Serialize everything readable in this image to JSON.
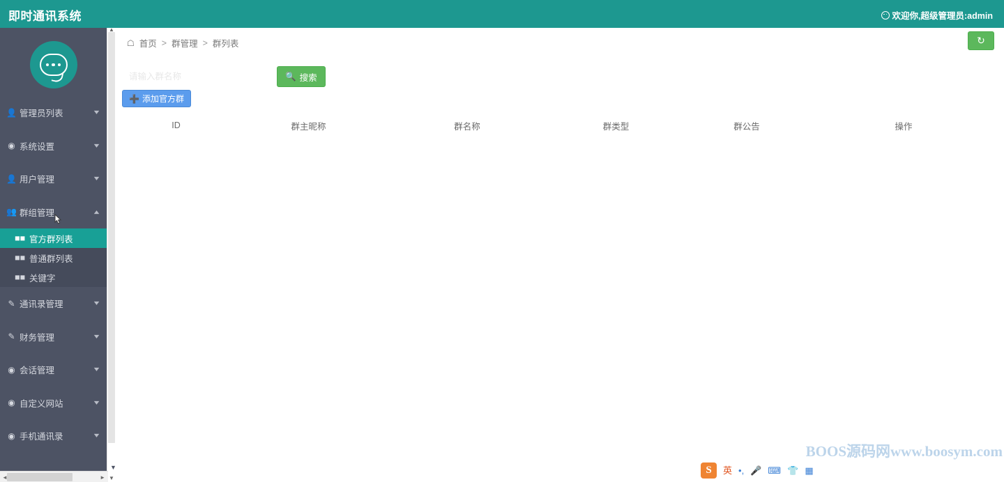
{
  "header": {
    "title": "即时通讯系统",
    "user_greeting": "欢迎你,超级管理员:admin",
    "smiley_icon": "smiley-face-icon",
    "bg_color": "#1d9890"
  },
  "sidebar": {
    "bg_color": "#4d5364",
    "logo_icon": "chat-bubble-logo",
    "active_color": "#18a096",
    "items": [
      {
        "label": "管理员列表",
        "icon": "user-icon",
        "caret": "chevron-down-icon",
        "expanded": false
      },
      {
        "label": "系统设置",
        "icon": "gear-icon",
        "caret": "chevron-down-icon",
        "expanded": false
      },
      {
        "label": "用户管理",
        "icon": "user-icon",
        "caret": "chevron-down-icon",
        "expanded": false
      },
      {
        "label": "群组管理",
        "icon": "users-group-icon",
        "caret": "chevron-up-icon",
        "expanded": true
      },
      {
        "label": "通讯录管理",
        "icon": "edit-square-icon",
        "caret": "chevron-down-icon",
        "expanded": false
      },
      {
        "label": "财务管理",
        "icon": "edit-square-icon",
        "caret": "chevron-down-icon",
        "expanded": false
      },
      {
        "label": "会话管理",
        "icon": "chat-circle-icon",
        "caret": "chevron-down-icon",
        "expanded": false
      },
      {
        "label": "自定义网站",
        "icon": "chat-circle-icon",
        "caret": "chevron-down-icon",
        "expanded": false
      },
      {
        "label": "手机通讯录",
        "icon": "chat-circle-icon",
        "caret": "chevron-down-icon",
        "expanded": false
      }
    ],
    "submenu": [
      {
        "label": "官方群列表",
        "icon": "list-icon",
        "active": true
      },
      {
        "label": "普通群列表",
        "icon": "list-icon",
        "active": false
      },
      {
        "label": "关键字",
        "icon": "list-icon",
        "active": false
      }
    ]
  },
  "main": {
    "breadcrumb": {
      "home_icon": "home-icon",
      "items": [
        "首页",
        "群管理",
        "群列表"
      ],
      "separator": ">"
    },
    "refresh_button": {
      "label": "refresh",
      "icon": "refresh-icon",
      "color": "#5cb85c"
    },
    "search": {
      "placeholder": "请输入群名称",
      "value": "",
      "button_label": "搜索",
      "button_icon": "search-icon",
      "button_color": "#5cb85c"
    },
    "add_button": {
      "label": "添加官方群",
      "icon": "plus-icon",
      "color": "#5b9ced"
    },
    "table": {
      "columns": [
        "ID",
        "群主昵称",
        "群名称",
        "群类型",
        "群公告",
        "操作"
      ],
      "rows": []
    }
  },
  "watermark": {
    "text": "BOOS源码网www.boosym.com",
    "color": "#bcd4ea"
  },
  "ime_bar": {
    "logo": "S",
    "items": [
      {
        "icon": "language-chinese-english-icon",
        "label": "英"
      },
      {
        "icon": "punctuation-icon",
        "label": "·,"
      },
      {
        "icon": "microphone-icon",
        "label": ""
      },
      {
        "icon": "keyboard-icon",
        "label": ""
      },
      {
        "icon": "skin-shirt-icon",
        "label": ""
      },
      {
        "icon": "toolbox-grid-icon",
        "label": ""
      }
    ]
  },
  "scrollbars": {
    "vertical_icon": "vertical-scrollbar",
    "horizontal_icon": "horizontal-scrollbar",
    "arrow_up": "▲",
    "arrow_down": "▼",
    "arrow_left": "◄",
    "arrow_right": "►"
  }
}
